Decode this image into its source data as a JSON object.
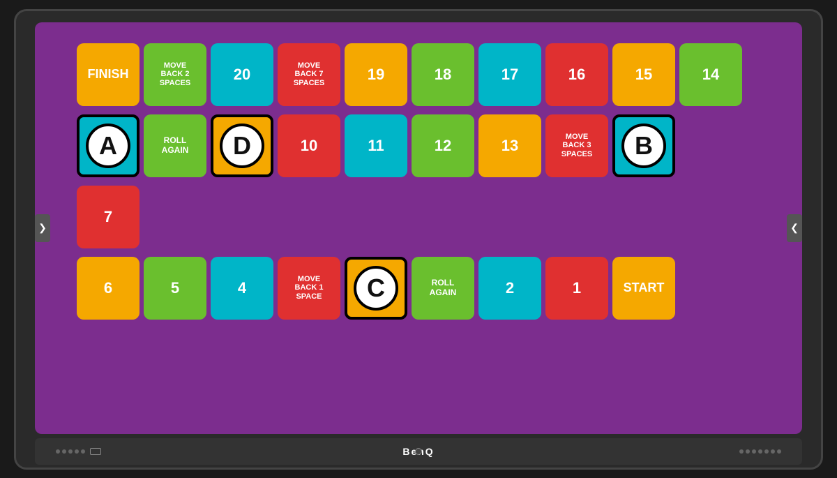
{
  "monitor": {
    "brand": "BenQ"
  },
  "board": {
    "rows": {
      "top": [
        {
          "id": "finish",
          "label": "FINISH",
          "color": "yellow",
          "type": "normal"
        },
        {
          "id": "move-back-2",
          "label": "MOVE\nBACK 2\nSPACES",
          "color": "green",
          "type": "normal"
        },
        {
          "id": "20",
          "label": "20",
          "color": "teal",
          "type": "normal"
        },
        {
          "id": "move-back-7",
          "label": "MOVE\nBACK 7\nSPACES",
          "color": "red",
          "type": "normal"
        },
        {
          "id": "19",
          "label": "19",
          "color": "yellow",
          "type": "normal"
        },
        {
          "id": "18",
          "label": "18",
          "color": "green",
          "type": "normal"
        },
        {
          "id": "17",
          "label": "17",
          "color": "teal",
          "type": "normal"
        },
        {
          "id": "16",
          "label": "16",
          "color": "red",
          "type": "normal"
        },
        {
          "id": "15",
          "label": "15",
          "color": "yellow",
          "type": "normal"
        }
      ],
      "mid": [
        {
          "id": "A",
          "label": "A",
          "color": "teal",
          "type": "circle"
        },
        {
          "id": "roll-again-1",
          "label": "ROLL\nAGAIN",
          "color": "green",
          "type": "normal"
        },
        {
          "id": "D",
          "label": "D",
          "color": "yellow",
          "type": "circle"
        },
        {
          "id": "10",
          "label": "10",
          "color": "red",
          "type": "normal"
        },
        {
          "id": "11",
          "label": "11",
          "color": "teal",
          "type": "normal"
        },
        {
          "id": "12",
          "label": "12",
          "color": "green",
          "type": "normal"
        },
        {
          "id": "13",
          "label": "13",
          "color": "yellow",
          "type": "normal"
        },
        {
          "id": "move-back-3",
          "label": "MOVE\nBACK 3\nSPACES",
          "color": "red",
          "type": "normal"
        },
        {
          "id": "B",
          "label": "B",
          "color": "teal",
          "type": "circle"
        }
      ],
      "bot": [
        {
          "id": "6",
          "label": "6",
          "color": "yellow",
          "type": "normal"
        },
        {
          "id": "5",
          "label": "5",
          "color": "green",
          "type": "normal"
        },
        {
          "id": "4",
          "label": "4",
          "color": "teal",
          "type": "normal"
        },
        {
          "id": "move-back-1",
          "label": "MOVE\nBACK 1\nSPACE",
          "color": "red",
          "type": "normal"
        },
        {
          "id": "C",
          "label": "C",
          "color": "yellow",
          "type": "circle"
        },
        {
          "id": "roll-again-2",
          "label": "ROLL\nAGAIN",
          "color": "green",
          "type": "normal"
        },
        {
          "id": "2",
          "label": "2",
          "color": "teal",
          "type": "normal"
        },
        {
          "id": "1",
          "label": "1",
          "color": "red",
          "type": "normal"
        },
        {
          "id": "start",
          "label": "START",
          "color": "yellow",
          "type": "normal"
        }
      ]
    },
    "right_connectors": {
      "top14": {
        "label": "14",
        "color": "green"
      },
      "right7": {
        "label": "7",
        "color": "red"
      }
    }
  },
  "arrows": {
    "left": "❯",
    "right": "❮"
  }
}
